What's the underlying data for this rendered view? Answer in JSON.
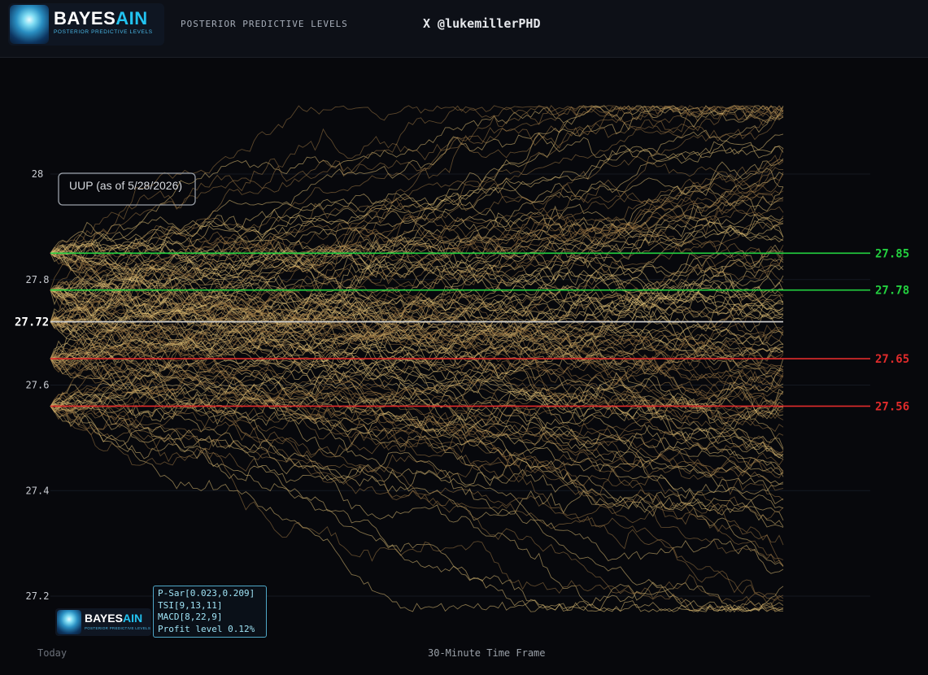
{
  "header": {
    "brand": {
      "name_main": "BAYES",
      "name_accent": "AIN",
      "tagline": "POSTERIOR PREDICTIVE LEVELS"
    },
    "title": "POSTERIOR PREDICTIVE LEVELS",
    "handle": "X @lukemillerPHD"
  },
  "chart_data": {
    "type": "line",
    "annotation": "UUP (as of 5/28/2026)",
    "xlabel": "30-Minute Time Frame",
    "x_start_label": "Today",
    "ylim": [
      27.17,
      28.15
    ],
    "yticks": [
      27.2,
      27.4,
      27.6,
      27.8,
      28
    ],
    "ytick_labels": [
      "27.2",
      "27.4",
      "27.6",
      "27.8",
      "28"
    ],
    "current_price": {
      "value": 27.72,
      "label": "27.72",
      "color": "#c9c9c9"
    },
    "levels": [
      {
        "value": 27.85,
        "label": "27.85",
        "color": "#23d13f"
      },
      {
        "value": 27.78,
        "label": "27.78",
        "color": "#23d13f"
      },
      {
        "value": 27.65,
        "label": "27.65",
        "color": "#e02b2b"
      },
      {
        "value": 27.56,
        "label": "27.56",
        "color": "#e02b2b"
      }
    ],
    "simulated_paths": {
      "count_per_level": 30,
      "horizon_steps": 180,
      "color_start": "#e8c77a",
      "color_end": "#a07a45",
      "terminal_range": [
        27.17,
        28.13
      ]
    },
    "grid": true
  },
  "indicators": [
    "P-Sar[0.023,0.209]",
    "TSI[9,13,11]",
    "MACD[8,22,9]",
    "Profit level 0.12%"
  ],
  "footer_brand": {
    "name_main": "BAYES",
    "name_accent": "AIN",
    "tagline": "POSTERIOR PREDICTIVE LEVELS"
  }
}
